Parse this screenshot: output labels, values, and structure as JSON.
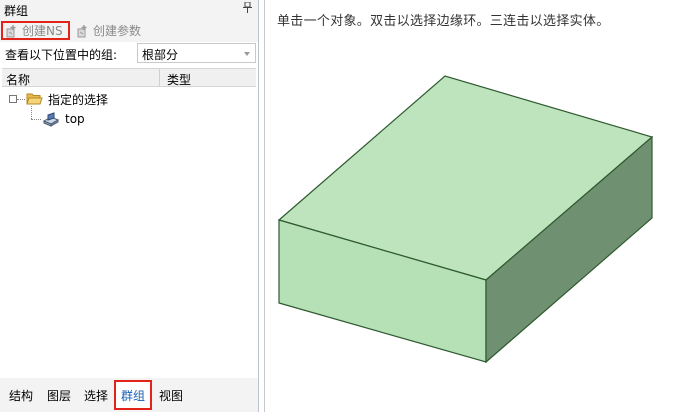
{
  "panel": {
    "title": "群组",
    "pin_icon": "pin-icon"
  },
  "toolbar": {
    "create_ns": "创建NS",
    "create_param": "创建参数"
  },
  "view_groups": {
    "label": "查看以下位置中的组:",
    "value": "根部分"
  },
  "columns": {
    "name": "名称",
    "type": "类型"
  },
  "tree": {
    "root": "指定的选择",
    "child": "top"
  },
  "tabs": [
    "结构",
    "图层",
    "选择",
    "群组",
    "视图"
  ],
  "active_tab": "群组",
  "viewport": {
    "hint": "单击一个对象。双击以选择边缘环。三连击以选择实体。"
  },
  "colors": {
    "highlight": "#e2231a",
    "box_top": "#bde4bd",
    "box_front": "#b6e0b6",
    "box_side": "#6f9172",
    "box_edge": "#2f5a2f"
  }
}
